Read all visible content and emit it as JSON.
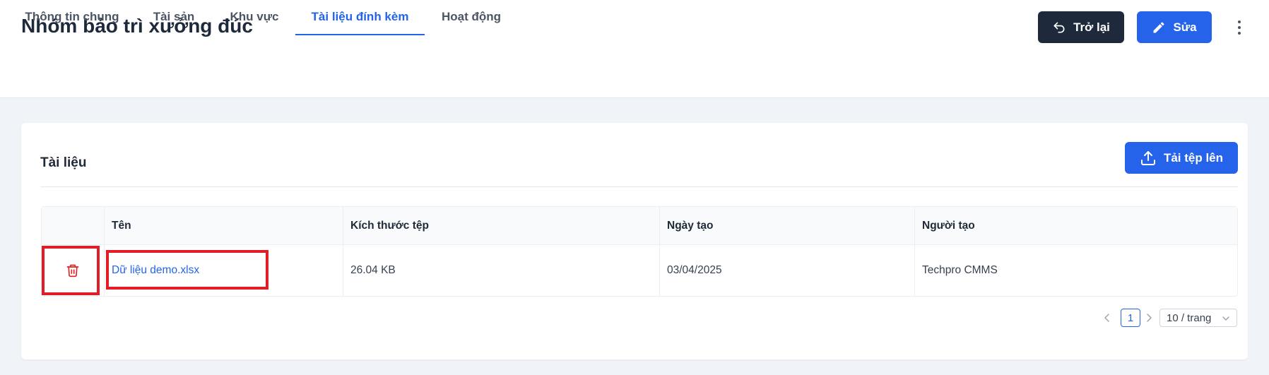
{
  "header": {
    "title": "Nhóm bảo trì xưởng đúc",
    "back_label": "Trở lại",
    "edit_label": "Sửa"
  },
  "tabs": [
    {
      "label": "Thông tin chung",
      "active": false
    },
    {
      "label": "Tài sản",
      "active": false
    },
    {
      "label": "Khu vực",
      "active": false
    },
    {
      "label": "Tài liệu đính kèm",
      "active": true
    },
    {
      "label": "Hoạt động",
      "active": false
    }
  ],
  "documents": {
    "title": "Tài liệu",
    "upload_label": "Tải tệp lên",
    "columns": [
      "Tên",
      "Kích thước tệp",
      "Ngày tạo",
      "Người tạo"
    ],
    "rows": [
      {
        "name": "Dữ liệu demo.xlsx",
        "size": "26.04 KB",
        "created": "03/04/2025",
        "creator": "Techpro CMMS"
      }
    ]
  },
  "pagination": {
    "current_page": "1",
    "page_size": "10 / trang"
  },
  "icons": {
    "back": "undo-arrow-icon",
    "edit": "pencil-icon",
    "more": "vertical-dots-icon",
    "upload": "upload-icon",
    "delete": "trash-icon",
    "prev": "chevron-left-icon",
    "next": "chevron-right-icon",
    "dropdown": "chevron-down-icon"
  },
  "colors": {
    "primary": "#2563eb",
    "dark_button": "#1e2a3b",
    "danger": "#dc2626",
    "highlight": "#e11d28"
  }
}
